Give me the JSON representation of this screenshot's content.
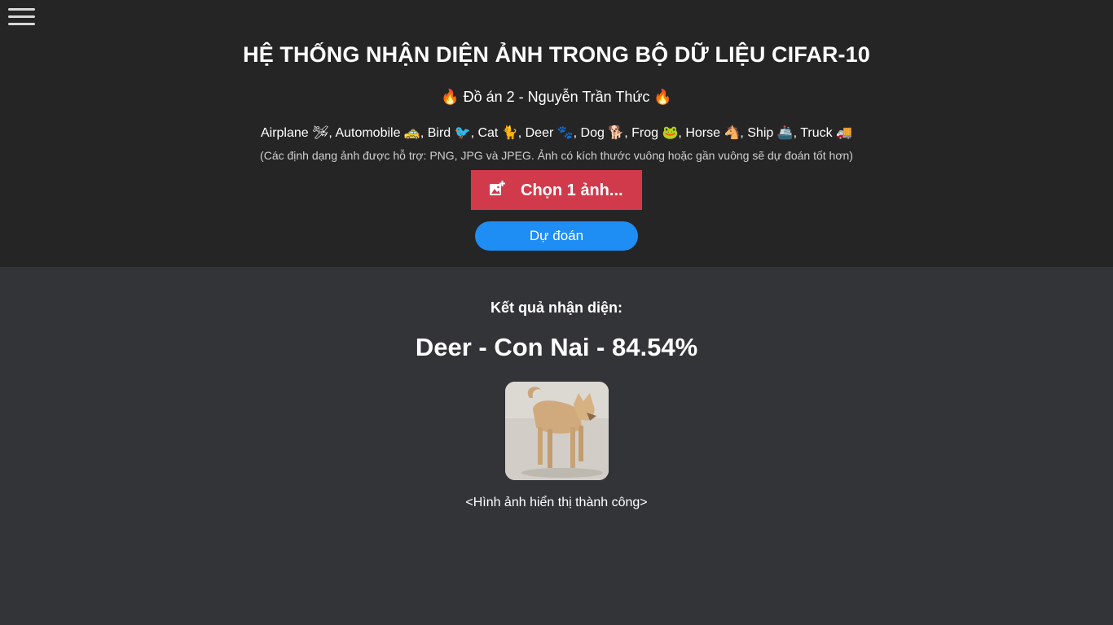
{
  "header": {
    "menu_icon": "hamburger-menu-icon",
    "title": "HỆ THỐNG NHẬN DIỆN ẢNH TRONG BỘ DỮ LIỆU CIFAR-10",
    "subtitle": "🔥 Đồ án 2 - Nguyễn Trần Thức 🔥",
    "classes_text": "Airplane 🛩, Automobile 🚕, Bird 🐦, Cat 🐈, Deer 🐾, Dog 🐕, Frog 🐸, Horse 🐴, Ship 🚢, Truck 🚚",
    "hint": "(Các định dạng ảnh được hỗ trợ: PNG, JPG và JPEG. Ảnh có kích thước vuông hoặc gần vuông sẽ dự đoán tốt hơn)",
    "choose_button": {
      "label": "Chọn 1 ảnh...",
      "icon": "add-photo-icon"
    },
    "predict_button": {
      "label": "Dự đoán"
    }
  },
  "result": {
    "label": "Kết quả nhận diện:",
    "value": "Deer - Con Nai - 84.54%",
    "status": "<Hình ảnh hiển thị thành công>"
  },
  "colors": {
    "header_bg": "#252526",
    "body_bg": "#333438",
    "choose_button": "#d13a4b",
    "predict_button": "#1e8ef5"
  }
}
